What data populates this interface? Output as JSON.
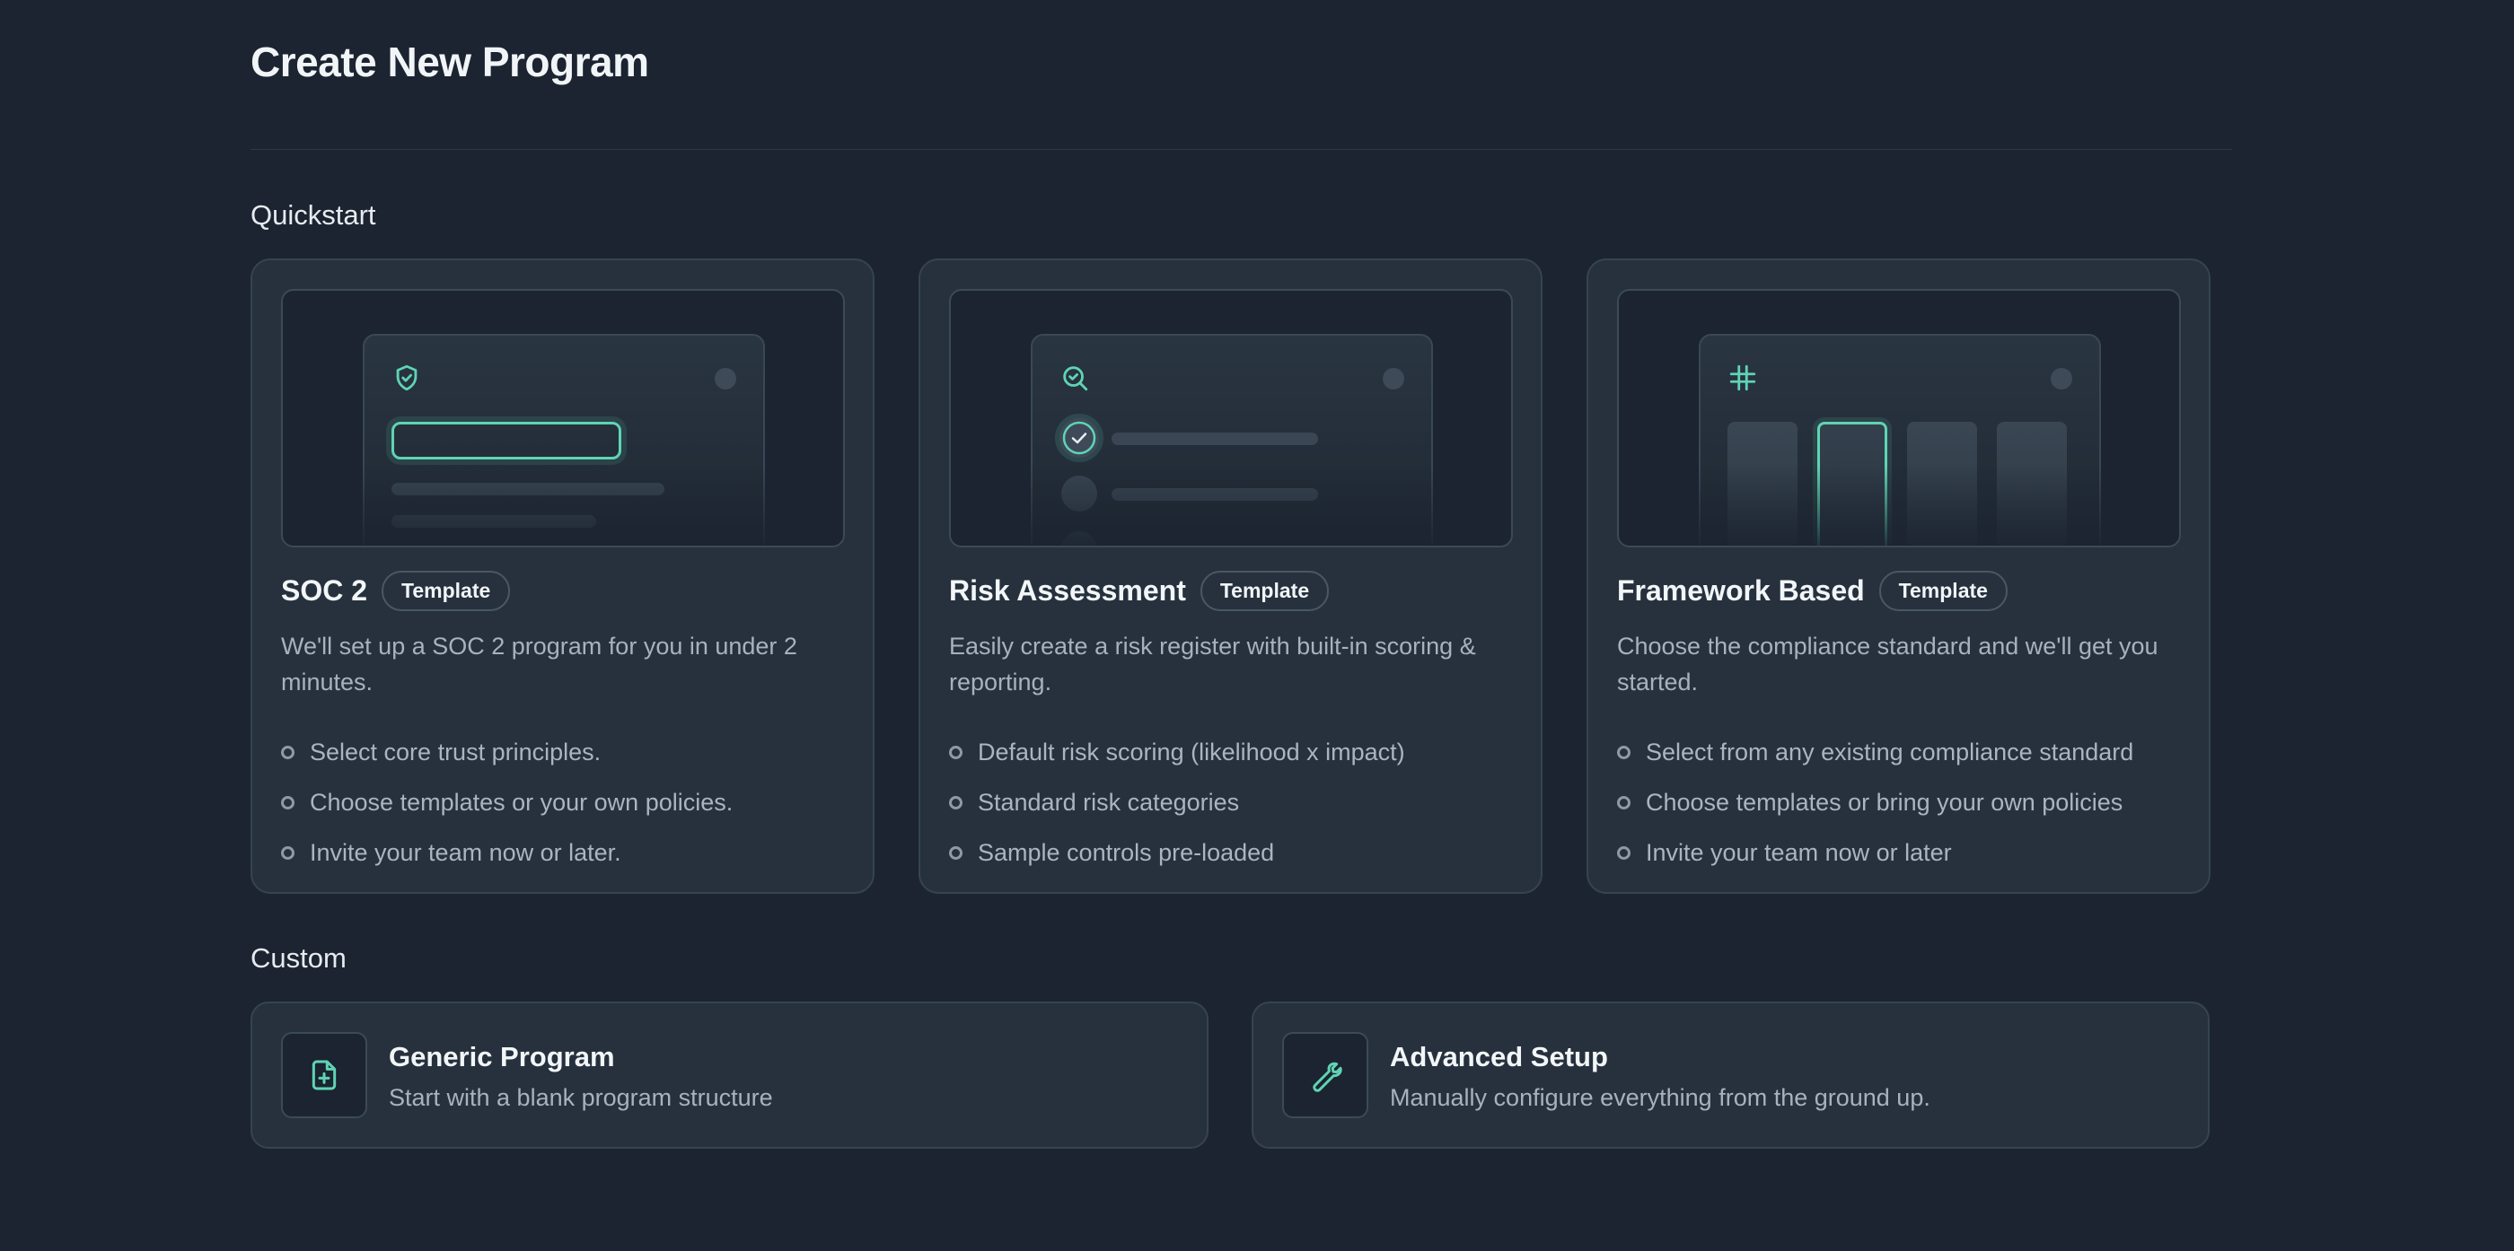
{
  "page": {
    "title": "Create New Program"
  },
  "colors": {
    "background": "#1b2430",
    "card": "#26313d",
    "accent": "#5fd4b4",
    "muted_text": "#a7b2be"
  },
  "quickstart": {
    "label": "Quickstart",
    "cards": [
      {
        "title": "SOC 2",
        "badge": "Template",
        "icon": "shield-check-icon",
        "description": "We'll set up a SOC 2 program for you in under 2 minutes.",
        "bullets": [
          "Select core trust principles.",
          "Choose templates or your own policies.",
          "Invite your team now or later."
        ]
      },
      {
        "title": "Risk Assessment",
        "badge": "Template",
        "icon": "search-check-icon",
        "description": "Easily create a risk register with built-in scoring & reporting.",
        "bullets": [
          "Default risk scoring (likelihood x impact)",
          "Standard risk categories",
          "Sample controls pre-loaded"
        ]
      },
      {
        "title": "Framework Based",
        "badge": "Template",
        "icon": "hash-icon",
        "description": "Choose the compliance standard and we'll get you started.",
        "bullets": [
          "Select from any existing compliance standard",
          "Choose templates or bring your own policies",
          "Invite your team now or later"
        ]
      }
    ]
  },
  "custom": {
    "label": "Custom",
    "cards": [
      {
        "title": "Generic Program",
        "description": "Start with a blank program structure",
        "icon": "file-plus-icon"
      },
      {
        "title": "Advanced Setup",
        "description": "Manually configure everything from the ground up.",
        "icon": "wrench-icon"
      }
    ]
  }
}
